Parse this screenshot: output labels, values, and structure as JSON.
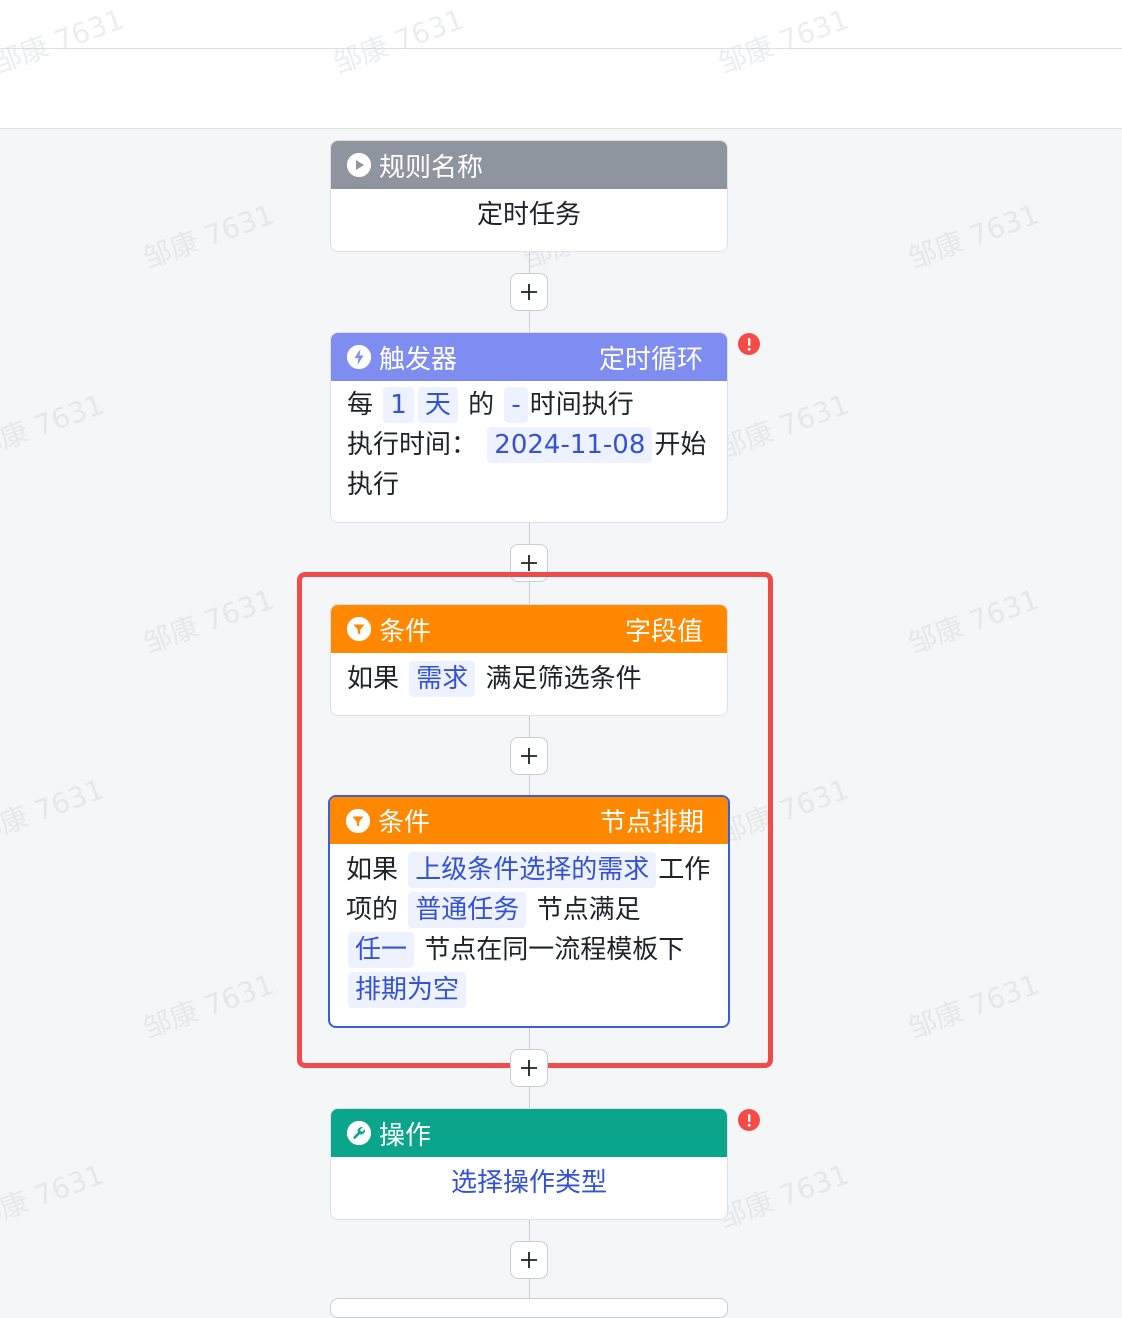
{
  "watermark": "邹康 7631",
  "flow": {
    "rule": {
      "header": "规则名称",
      "name": "定时任务"
    },
    "trigger": {
      "header": "触发器",
      "type": "定时循环",
      "line1": {
        "prefix": "每",
        "count": "1",
        "unit": "天",
        "mid": "的",
        "time": "-",
        "suffix": "时间执行"
      },
      "line2": {
        "label": "执行时间：",
        "date": "2024-11-08",
        "suffix": "开始执行"
      }
    },
    "condition1": {
      "header": "条件",
      "type": "字段值",
      "prefix": "如果",
      "object": "需求",
      "suffix": "满足筛选条件"
    },
    "condition2": {
      "header": "条件",
      "type": "节点排期",
      "prefix": "如果",
      "chip1": "上级条件选择的需求",
      "text1": "工作项的",
      "chip2": "普通任务",
      "text2": "节点满足",
      "chip3": "任一",
      "text3": "节点在同一流程模板下",
      "chip4": "排期为空"
    },
    "action": {
      "header": "操作",
      "placeholder": "选择操作类型"
    }
  },
  "colors": {
    "rule_header": "#8f959e",
    "trigger_header": "#7f8cf0",
    "condition_header": "#ff8800",
    "action_header": "#0aa58a",
    "selected_border": "#3e5bd8",
    "highlight_box": "#f04b4b",
    "warning": "#f54a45"
  },
  "icons": {
    "rule": "play-icon",
    "trigger": "lightning-icon",
    "condition": "filter-icon",
    "action": "wrench-icon",
    "add": "plus-icon",
    "warning": "exclamation-icon"
  }
}
